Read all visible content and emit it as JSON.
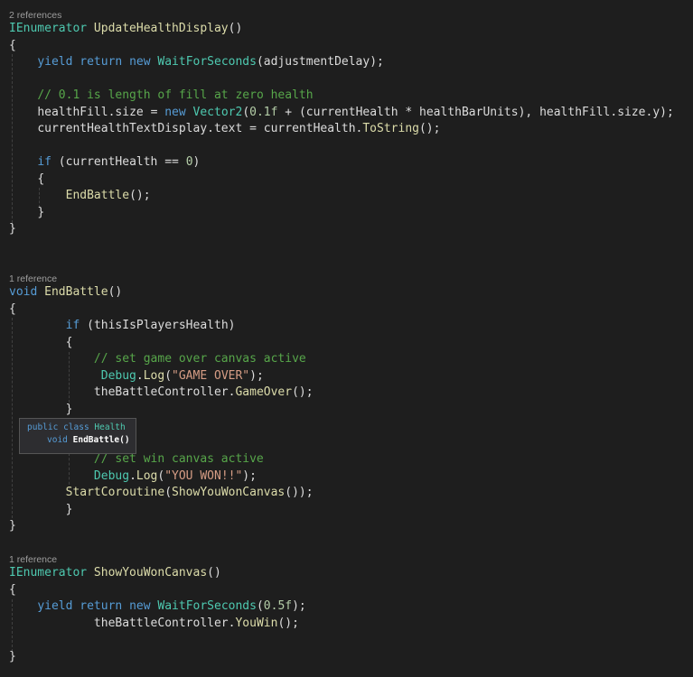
{
  "refs": {
    "r1": "2 references",
    "r2": "1 reference",
    "r3": "1 reference"
  },
  "tokens": {
    "ienum": "IEnumerator",
    "update_health_display": "UpdateHealthDisplay",
    "void_kw": "void",
    "end_battle": "EndBattle",
    "show_you_won_canvas": "ShowYouWonCanvas",
    "yield": "yield",
    "return": "return",
    "new": "new",
    "wait_for_seconds": "WaitForSeconds",
    "adjustment_delay": "adjustmentDelay",
    "comment_fill": "// 0.1 is length of fill at zero health",
    "health_fill": "healthFill",
    "size": "size",
    "vector2": "Vector2",
    "num_01f": "0.1f",
    "current_health": "currentHealth",
    "health_bar_units": "healthBarUnits",
    "y": "y",
    "current_health_text_display": "currentHealthTextDisplay",
    "text": "text",
    "to_string": "ToString",
    "if": "if",
    "zero": "0",
    "this_is_players_health": "thisIsPlayersHealth",
    "comment_game_over": "// set game over canvas active",
    "debug": "Debug",
    "log": "Log",
    "str_game_over": "\"GAME OVER\"",
    "battle_controller": "theBattleController",
    "game_over": "GameOver",
    "comment_win": "// set win canvas active",
    "str_you_won": "\"YOU WON!!\"",
    "start_coroutine": "StartCoroutine",
    "num_05f": "0.5f",
    "you_win": "YouWin"
  },
  "tooltip": {
    "kw_public": "public",
    "kw_class": "class",
    "type_health": "Health",
    "kw_void": "void",
    "method": "EndBattle()"
  },
  "colors": {
    "background": "#1e1e1e",
    "keyword": "#569cd6",
    "type": "#4ec9b0",
    "method": "#dcdcaa",
    "comment": "#57a64a",
    "string": "#d69d85",
    "number": "#b5cea8"
  }
}
